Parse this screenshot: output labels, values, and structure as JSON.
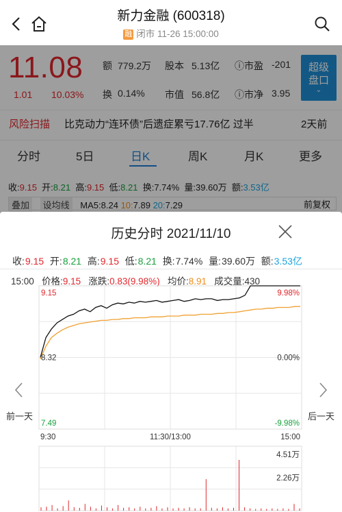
{
  "header": {
    "title": "新力金融 (600318)",
    "badge": "融",
    "status": "闭市 11-26 15:00:00"
  },
  "quote": {
    "price": "11.08",
    "change": "1.01",
    "change_pct": "10.03%",
    "amount_label": "额",
    "amount_value": "779.2万",
    "share_cap_label": "股本",
    "share_cap_value": "5.13亿",
    "pe_label": "市盈",
    "pe_value": "-201",
    "turnover_label": "换",
    "turnover_value": "0.14%",
    "mkt_value_label": "市值",
    "mkt_value_value": "56.8亿",
    "pb_label": "市净",
    "pb_value": "3.95",
    "super_btn_line1": "超级",
    "super_btn_line2": "盘口"
  },
  "risk": {
    "label": "风险扫描",
    "text": "比克动力“连环债”后遗症累亏17.76亿 过半",
    "time": "2天前"
  },
  "tabs": [
    "分时",
    "5日",
    "日K",
    "周K",
    "月K",
    "更多"
  ],
  "kline_info": {
    "close_label": "收:",
    "close": "9.15",
    "open_label": "开:",
    "open": "8.21",
    "high_label": "高:",
    "high": "9.15",
    "low_label": "低:",
    "low": "8.21",
    "turn_label": "换:",
    "turn": "7.74%",
    "vol_label": "量:",
    "vol": "39.60万",
    "amt_label": "额:",
    "amt": "3.53亿"
  },
  "ma_row": {
    "btn_overlay": "叠加",
    "btn_ma": "设均线",
    "ma5_label": "MA5:",
    "ma5": "8.24",
    "ma10_label": "10:",
    "ma10": "7.89",
    "ma20_label": "20:",
    "ma20": "7.29",
    "adjust": "前复权"
  },
  "modal": {
    "title": "历史分时 2021/11/10",
    "stats": {
      "close_label": "收:",
      "close": "9.15",
      "open_label": "开:",
      "open": "8.21",
      "high_label": "高:",
      "high": "9.15",
      "low_label": "低:",
      "low": "8.21",
      "turn_label": "换:",
      "turn": "7.74%",
      "vol_label": "量:",
      "vol": "39.60万",
      "amt_label": "额:",
      "amt": "3.53亿"
    },
    "cursor": {
      "time": "15:00",
      "price_label": "价格:",
      "price": "9.15",
      "chg_label": "涨跌:",
      "chg": "0.83(9.98%)",
      "avg_label": "均价:",
      "avg": "8.91",
      "vol_label": "成交量:",
      "vol": "430"
    },
    "prev_day": "前一天",
    "next_day": "后一天"
  },
  "chart_data": {
    "type": "line",
    "y_left_ticks": [
      "9.15",
      "8.32",
      "7.49"
    ],
    "y_right_ticks": [
      "9.98%",
      "0.00%",
      "-9.98%"
    ],
    "x_ticks": [
      "9:30",
      "11:30/13:00",
      "15:00"
    ],
    "ylim": [
      7.49,
      9.15
    ],
    "volume_ticks": [
      "4.51万",
      "2.26万"
    ],
    "series": [
      {
        "values": [
          8.32,
          8.55,
          8.65,
          8.72,
          8.76,
          8.8,
          8.82,
          8.86,
          8.88,
          8.85,
          8.9,
          8.92,
          8.89,
          8.93,
          8.95,
          8.94,
          8.96,
          8.95,
          8.97,
          8.96,
          8.97,
          8.98,
          8.96,
          8.97,
          8.98,
          8.99,
          8.97,
          8.98,
          9.0,
          8.99,
          9.0,
          9.0,
          8.98,
          8.99,
          8.99,
          9.0,
          9.01,
          9.04,
          9.15,
          9.15,
          9.15,
          9.15,
          9.15,
          9.15,
          9.15,
          9.15,
          9.15,
          9.15
        ]
      },
      {
        "values": [
          8.3,
          8.45,
          8.55,
          8.6,
          8.64,
          8.67,
          8.69,
          8.71,
          8.72,
          8.73,
          8.74,
          8.75,
          8.75,
          8.76,
          8.76,
          8.77,
          8.77,
          8.78,
          8.78,
          8.78,
          8.79,
          8.79,
          8.79,
          8.8,
          8.8,
          8.8,
          8.81,
          8.81,
          8.81,
          8.82,
          8.82,
          8.82,
          8.83,
          8.83,
          8.84,
          8.84,
          8.85,
          8.86,
          8.87,
          8.88,
          8.88,
          8.89,
          8.89,
          8.9,
          8.9,
          8.9,
          8.91,
          8.91
        ]
      }
    ],
    "volume": [
      0.3,
      0.35,
      0.5,
      0.2,
      0.4,
      0.9,
      0.3,
      0.25,
      0.6,
      0.35,
      0.2,
      0.45,
      0.3,
      0.2,
      0.5,
      0.25,
      0.3,
      0.2,
      0.35,
      0.2,
      0.25,
      0.4,
      0.2,
      0.3,
      0.2,
      0.25,
      0.2,
      0.3,
      0.2,
      0.2,
      2.8,
      0.25,
      0.2,
      0.3,
      0.2,
      0.25,
      4.51,
      0.3,
      0.2,
      0.15,
      0.2,
      0.15,
      0.2,
      0.15,
      0.2,
      0.15,
      0.6,
      0.2
    ]
  },
  "colors": {
    "up": "#e0262c",
    "down": "#18a03c",
    "price_line": "#111111",
    "avg_line": "#f0a030",
    "accent": "#1f8fd6"
  }
}
